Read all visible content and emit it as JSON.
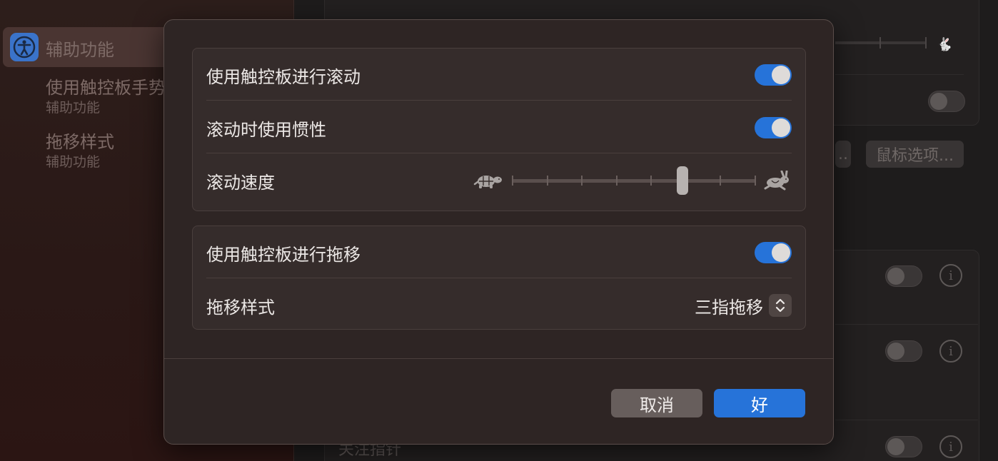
{
  "sidebar": {
    "active_item": {
      "label": "辅助功能",
      "icon": "accessibility-icon"
    },
    "items": [
      {
        "label": "使用触控板手势",
        "sublabel": "辅助功能"
      },
      {
        "label": "拖移样式",
        "sublabel": "辅助功能"
      }
    ]
  },
  "background": {
    "mouse_options_label": "鼠标选项...",
    "partial_button_label": "..",
    "partial_text": "关注指针"
  },
  "sheet": {
    "group1": {
      "scroll_toggle": {
        "label": "使用触控板进行滚动",
        "on": true
      },
      "inertia_toggle": {
        "label": "滚动时使用惯性",
        "on": true
      },
      "scroll_speed": {
        "label": "滚动速度",
        "min_icon": "tortoise-icon",
        "max_icon": "hare-icon",
        "ticks": 8,
        "value_fraction": 0.7
      }
    },
    "group2": {
      "drag_toggle": {
        "label": "使用触控板进行拖移",
        "on": true
      },
      "drag_style": {
        "label": "拖移样式",
        "value": "三指拖移"
      }
    },
    "cancel_label": "取消",
    "ok_label": "好"
  },
  "colors": {
    "accent": "#2673d9",
    "sheet_bg": "#2e2524",
    "group_bg": "#352c2b"
  }
}
